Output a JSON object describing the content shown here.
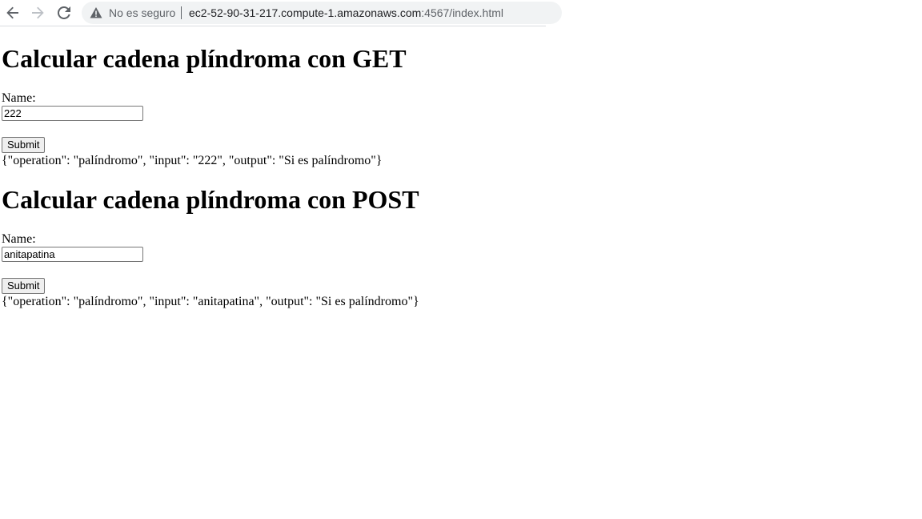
{
  "browser": {
    "back_icon": "arrow-left-icon",
    "forward_icon": "arrow-right-icon",
    "reload_icon": "reload-icon",
    "security_icon": "warning-triangle-icon",
    "security_label": "No es seguro",
    "url_host": "ec2-52-90-31-217.compute-1.amazonaws.com",
    "url_path": ":4567/index.html"
  },
  "get_section": {
    "title": "Calcular cadena plíndroma con GET",
    "name_label": "Name:",
    "name_value": "222",
    "submit_label": "Submit",
    "result": "{\"operation\": \"palíndromo\", \"input\": \"222\", \"output\": \"Si es palíndromo\"}"
  },
  "post_section": {
    "title": "Calcular cadena plíndroma con POST",
    "name_label": "Name:",
    "name_value": "anitapatina",
    "submit_label": "Submit",
    "result": "{\"operation\": \"palíndromo\", \"input\": \"anitapatina\", \"output\": \"Si es palíndromo\"}"
  }
}
